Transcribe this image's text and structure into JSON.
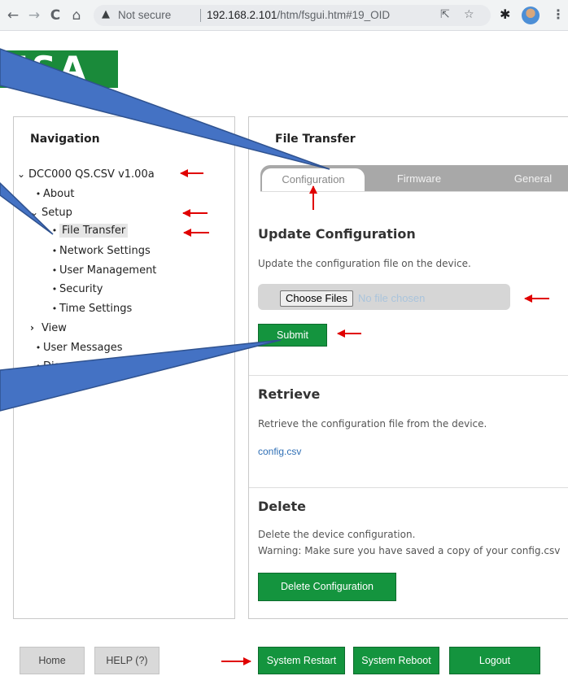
{
  "browser": {
    "back_icon": "←",
    "forward_icon": "→",
    "reload_icon": "C",
    "home_icon": "⌂",
    "security_warning": "Not secure",
    "url_host": "192.168.2.101",
    "url_path": "/htm/fsgui.htm#19_OID"
  },
  "logo_text": "FSA",
  "navigation": {
    "title": "Navigation",
    "items": [
      {
        "label": "DCC000 QS.CSV v1.00a",
        "glyph": "expanded"
      },
      {
        "label": "About",
        "glyph": "bullet"
      },
      {
        "label": "Setup",
        "glyph": "expanded"
      },
      {
        "label": "File Transfer",
        "glyph": "bullet",
        "active": true
      },
      {
        "label": "Network Settings",
        "glyph": "bullet"
      },
      {
        "label": "User Management",
        "glyph": "bullet"
      },
      {
        "label": "Security",
        "glyph": "bullet"
      },
      {
        "label": "Time Settings",
        "glyph": "bullet"
      },
      {
        "label": "View",
        "glyph": "collapsed"
      },
      {
        "label": "User Messages",
        "glyph": "bullet"
      },
      {
        "label": "Diagnostics",
        "glyph": "bullet"
      }
    ]
  },
  "main": {
    "title": "File Transfer",
    "tabs": [
      {
        "label": "Configuration",
        "active": true
      },
      {
        "label": "Firmware",
        "active": false
      },
      {
        "label": "General",
        "active": false
      }
    ],
    "update": {
      "heading": "Update Configuration",
      "description": "Update the configuration file on the device.",
      "choose_label": "Choose Files",
      "no_file": "No file chosen",
      "submit_label": "Submit"
    },
    "retrieve": {
      "heading": "Retrieve",
      "description": "Retrieve the configuration file from the device.",
      "link": "config.csv"
    },
    "delete": {
      "heading": "Delete",
      "description": "Delete the device configuration.",
      "warning": "Warning: Make sure you have saved a copy of your config.csv",
      "button_label": "Delete Configuration"
    }
  },
  "footer": {
    "home": "Home",
    "help": "HELP (?)",
    "restart": "System Restart",
    "reboot": "System Reboot",
    "logout": "Logout"
  },
  "colors": {
    "brand_green": "#14943e",
    "callout_blue": "#4472c4",
    "annotation_red": "#e00000"
  }
}
